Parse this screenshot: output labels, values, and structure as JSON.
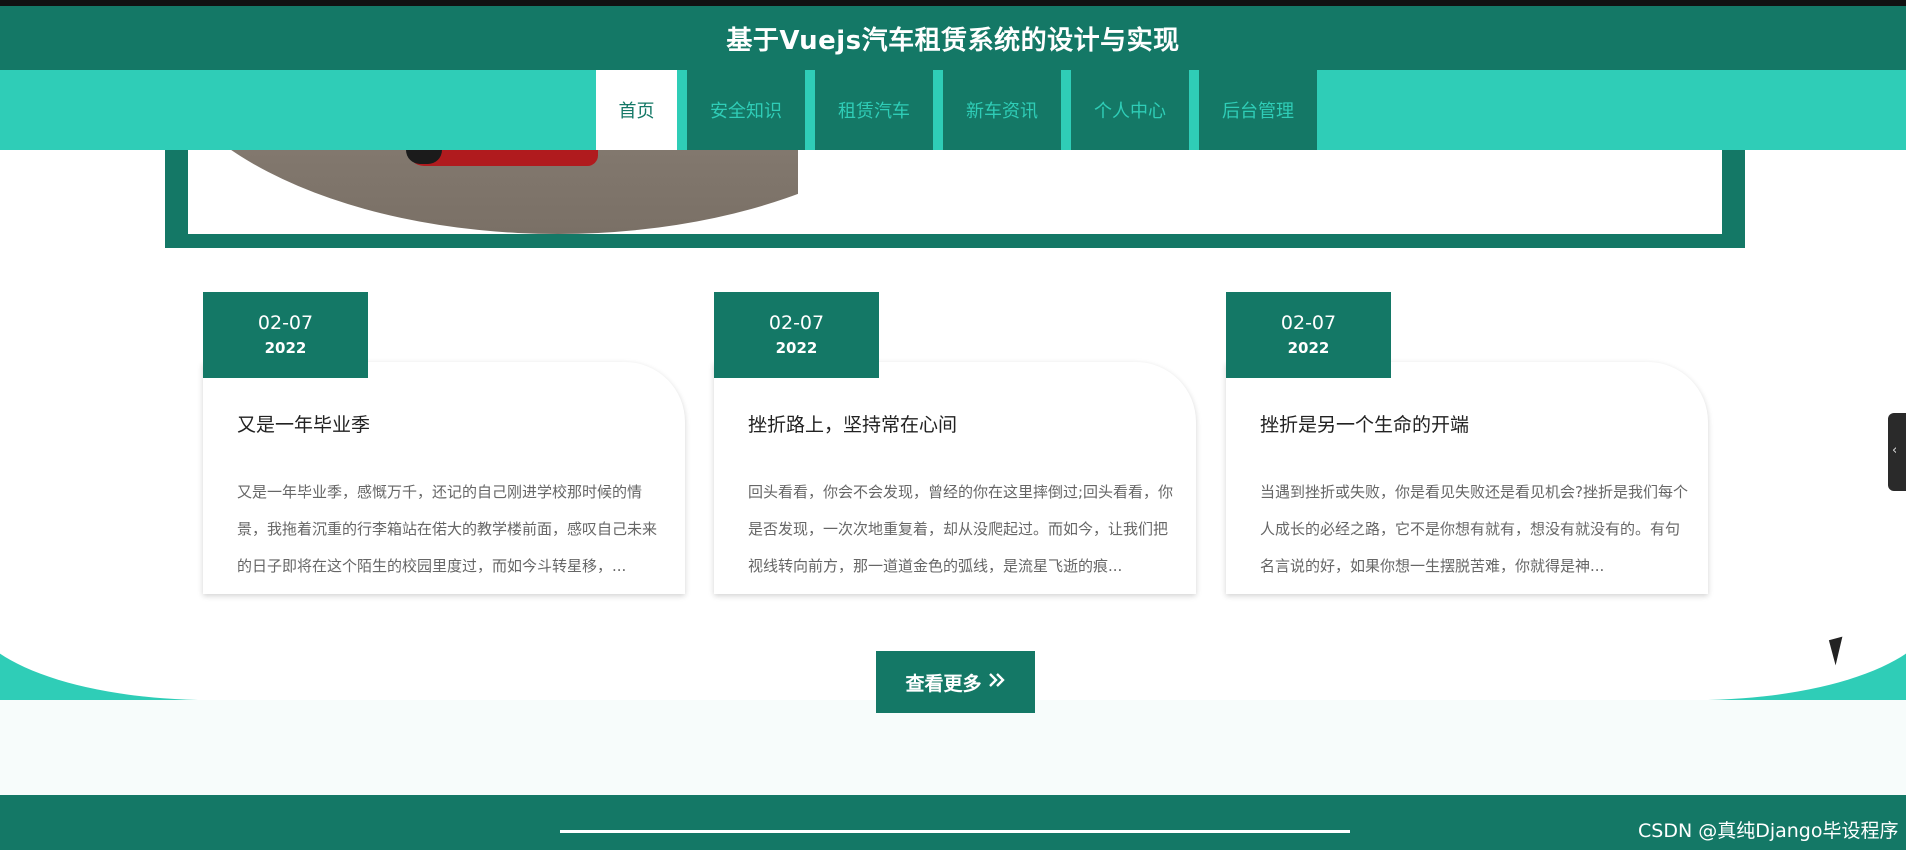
{
  "header": {
    "title": "基于Vuejs汽车租赁系统的设计与实现"
  },
  "nav": {
    "items": [
      {
        "label": "首页",
        "active": true
      },
      {
        "label": "安全知识",
        "active": false
      },
      {
        "label": "租赁汽车",
        "active": false
      },
      {
        "label": "新车资讯",
        "active": false
      },
      {
        "label": "个人中心",
        "active": false
      },
      {
        "label": "后台管理",
        "active": false
      }
    ]
  },
  "news": [
    {
      "date": "02-07",
      "year": "2022",
      "title": "又是一年毕业季",
      "summary": "又是一年毕业季，感慨万千，还记的自己刚进学校那时候的情景，我拖着沉重的行李箱站在偌大的教学楼前面，感叹自己未来的日子即将在这个陌生的校园里度过，而如今斗转星移，..."
    },
    {
      "date": "02-07",
      "year": "2022",
      "title": "挫折路上，坚持常在心间",
      "summary": "回头看看，你会不会发现，曾经的你在这里摔倒过;回头看看，你是否发现，一次次地重复着，却从没爬起过。而如今，让我们把视线转向前方，那一道道金色的弧线，是流星飞逝的痕..."
    },
    {
      "date": "02-07",
      "year": "2022",
      "title": "挫折是另一个生命的开端",
      "summary": "当遇到挫折或失败，你是看见失败还是看见机会?挫折是我们每个人成长的必经之路，它不是你想有就有，想没有就没有的。有句名言说的好，如果你想一生摆脱苦难，你就得是神..."
    }
  ],
  "more_button": {
    "label": "查看更多"
  },
  "watermark": {
    "text": "CSDN @真纯Django毕设程序"
  },
  "colors": {
    "primary": "#147866",
    "accent": "#2fcdb7"
  }
}
